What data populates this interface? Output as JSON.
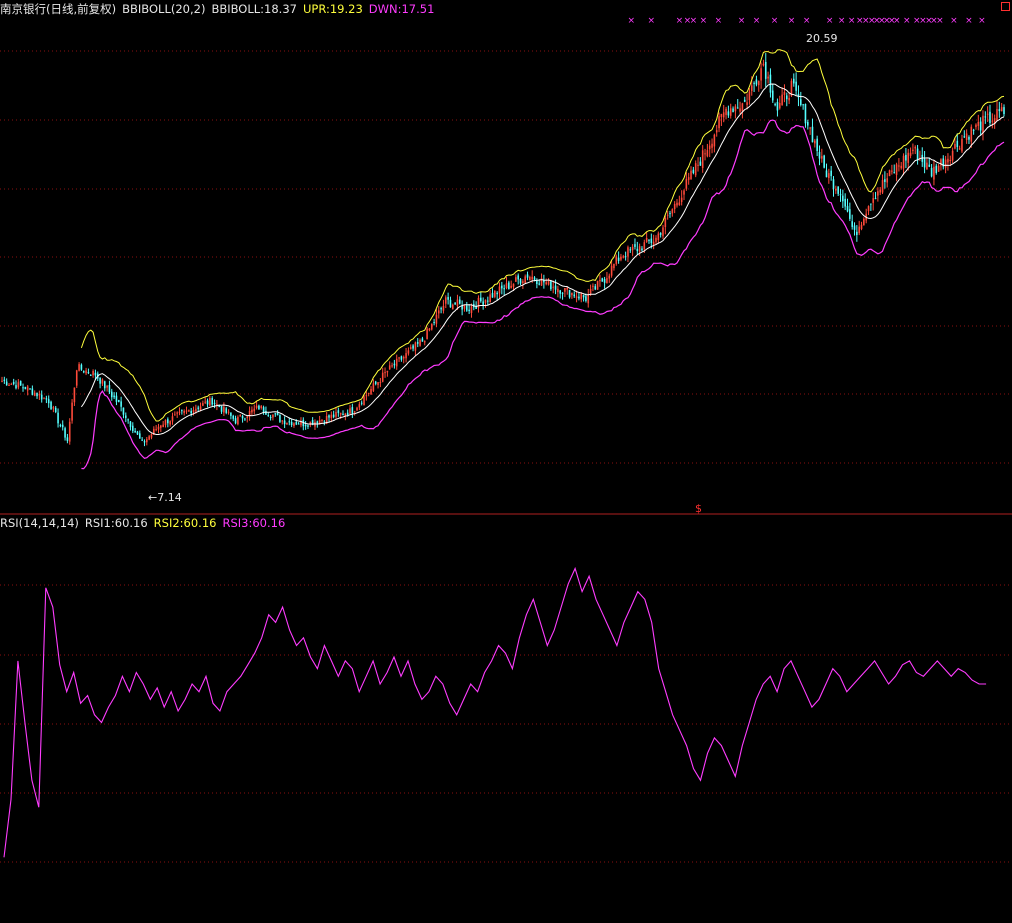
{
  "header": {
    "stock_name": "南京银行(日线,前复权)",
    "indicator": "BBIBOLL(20,2)",
    "bbiboll_value": "BBIBOLL:18.37",
    "upr_value": "UPR:19.23",
    "dwn_value": "DWN:17.51"
  },
  "rsi_header": {
    "indicator": "RSI(14,14,14)",
    "rsi1_value": "RSI1:60.16",
    "rsi2_value": "RSI2:60.16",
    "rsi3_value": "RSI3:60.16"
  },
  "annotations": {
    "low_label": "←7.14",
    "high_label": "20.59",
    "split_marker": "$"
  },
  "colors": {
    "background": "#000000",
    "up": "#ff4a3a",
    "down": "#54ffff",
    "mid_line": "#ffffff",
    "upper_band": "#ffff3c",
    "lower_band": "#ff3cff",
    "rsi_line": "#ff3cff",
    "grid": "#8a1010",
    "signal": "#ff3cff"
  },
  "chart_data": [
    {
      "type": "candlestick",
      "title": "南京银行(日线,前复权)",
      "series": [
        {
          "name": "BBIBOLL",
          "role": "middle band",
          "last": 18.37
        },
        {
          "name": "UPR",
          "role": "upper band",
          "last": 19.23
        },
        {
          "name": "DWN",
          "role": "lower band",
          "last": 17.51
        }
      ],
      "low_point": 7.14,
      "high_point": 20.59,
      "grid": true,
      "price_path": [
        [
          0,
          10.2
        ],
        [
          10,
          10.0
        ],
        [
          20,
          9.6
        ],
        [
          28,
          8.4
        ],
        [
          32,
          10.6
        ],
        [
          40,
          10.4
        ],
        [
          50,
          9.5
        ],
        [
          60,
          8.3
        ],
        [
          68,
          8.9
        ],
        [
          80,
          9.3
        ],
        [
          90,
          9.6
        ],
        [
          100,
          9.0
        ],
        [
          110,
          9.4
        ],
        [
          120,
          9.0
        ],
        [
          130,
          8.9
        ],
        [
          140,
          9.1
        ],
        [
          150,
          9.3
        ],
        [
          165,
          10.5
        ],
        [
          180,
          11.4
        ],
        [
          190,
          12.6
        ],
        [
          200,
          12.4
        ],
        [
          210,
          12.8
        ],
        [
          225,
          13.4
        ],
        [
          235,
          13.1
        ],
        [
          242,
          12.9
        ],
        [
          250,
          12.7
        ],
        [
          258,
          13.3
        ],
        [
          265,
          14.0
        ],
        [
          272,
          14.2
        ],
        [
          280,
          14.5
        ],
        [
          292,
          16.0
        ],
        [
          300,
          17.0
        ],
        [
          310,
          18.4
        ],
        [
          318,
          18.6
        ],
        [
          326,
          19.8
        ],
        [
          332,
          18.4
        ],
        [
          338,
          19.1
        ],
        [
          344,
          18.2
        ],
        [
          352,
          16.6
        ],
        [
          360,
          15.8
        ],
        [
          365,
          14.6
        ],
        [
          372,
          15.7
        ],
        [
          380,
          16.4
        ],
        [
          390,
          17.2
        ],
        [
          398,
          16.5
        ],
        [
          405,
          17.0
        ],
        [
          412,
          17.6
        ],
        [
          420,
          18.0
        ],
        [
          428,
          18.3
        ]
      ],
      "signal_markers": [
        0.628,
        0.648,
        0.676,
        0.684,
        0.69,
        0.7,
        0.715,
        0.738,
        0.753,
        0.771,
        0.788,
        0.803,
        0.826,
        0.838,
        0.848,
        0.856,
        0.862,
        0.868,
        0.873,
        0.878,
        0.883,
        0.888,
        0.893,
        0.903,
        0.913,
        0.919,
        0.925,
        0.93,
        0.936,
        0.95,
        0.965,
        0.978
      ]
    },
    {
      "type": "line",
      "title": "RSI(14,14,14)",
      "series": [
        {
          "name": "RSI1",
          "last": 60.16
        },
        {
          "name": "RSI2",
          "last": 60.16
        },
        {
          "name": "RSI3",
          "last": 60.16
        }
      ],
      "ylim": [
        0,
        100
      ],
      "grid": true,
      "x": [
        0,
        3,
        6,
        9,
        12,
        15,
        18,
        21,
        24,
        27,
        30,
        33,
        36,
        39,
        42,
        45,
        48,
        51,
        54,
        57,
        60,
        63,
        66,
        69,
        72,
        75,
        78,
        81,
        84,
        87,
        90,
        93,
        96,
        99,
        102,
        105,
        108,
        111,
        114,
        117,
        120,
        123,
        126,
        129,
        132,
        135,
        138,
        141,
        144,
        147,
        150,
        153,
        156,
        159,
        162,
        165,
        168,
        171,
        174,
        177,
        180,
        183,
        186,
        189,
        192,
        195,
        198,
        201,
        204,
        207,
        210,
        213,
        216,
        219,
        222,
        225,
        228,
        231,
        234,
        237,
        240,
        243,
        246,
        249,
        252,
        255,
        258,
        261,
        264,
        267,
        270,
        273,
        276,
        279,
        282,
        285,
        288,
        291,
        294,
        297,
        300,
        303,
        306,
        309,
        312,
        315,
        318,
        321,
        324,
        327,
        330,
        333,
        336,
        339,
        342,
        345,
        348,
        351,
        354,
        357,
        360,
        363,
        366,
        369,
        372,
        375,
        378,
        381,
        384,
        387,
        390,
        393,
        396,
        399,
        402,
        405,
        408,
        411,
        414,
        417,
        420,
        423,
        426,
        429
      ],
      "values": [
        15,
        30,
        66,
        50,
        35,
        28,
        85,
        80,
        65,
        58,
        63,
        55,
        57,
        52,
        50,
        54,
        57,
        62,
        58,
        63,
        60,
        56,
        59,
        54,
        58,
        53,
        56,
        60,
        58,
        62,
        55,
        53,
        58,
        60,
        62,
        65,
        68,
        72,
        78,
        76,
        80,
        74,
        70,
        72,
        67,
        64,
        70,
        66,
        62,
        66,
        64,
        58,
        62,
        66,
        60,
        63,
        67,
        62,
        66,
        60,
        56,
        58,
        62,
        60,
        55,
        52,
        56,
        60,
        58,
        63,
        66,
        70,
        68,
        64,
        72,
        78,
        82,
        76,
        70,
        74,
        80,
        86,
        90,
        84,
        88,
        82,
        78,
        74,
        70,
        76,
        80,
        84,
        82,
        76,
        64,
        58,
        52,
        48,
        44,
        38,
        35,
        42,
        46,
        44,
        40,
        36,
        44,
        50,
        56,
        60,
        62,
        58,
        64,
        66,
        62,
        58,
        54,
        56,
        60,
        64,
        62,
        58,
        60,
        62,
        64,
        66,
        63,
        60,
        62,
        65,
        66,
        63,
        62,
        64,
        66,
        64,
        62,
        64,
        63,
        61,
        60,
        60
      ]
    }
  ]
}
